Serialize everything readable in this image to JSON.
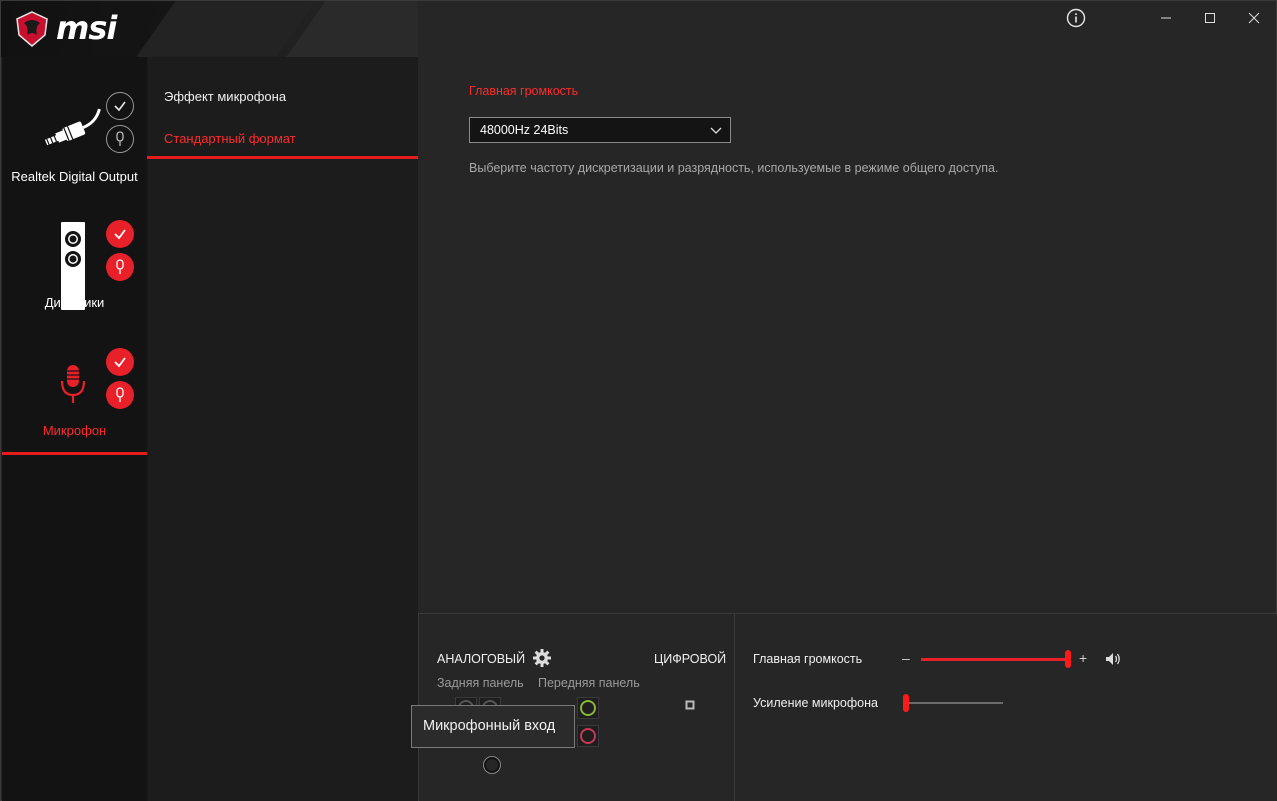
{
  "app": {
    "logo_text": "msi"
  },
  "devices": [
    {
      "label": "Realtek Digital Output",
      "icon": "digital-output-cable-icon",
      "active": false
    },
    {
      "label": "Динамики",
      "icon": "speakers-icon",
      "active": false
    },
    {
      "label": "Микрофон",
      "icon": "microphone-icon",
      "active": true
    }
  ],
  "submenu": {
    "items": [
      {
        "label": "Эффект микрофона",
        "active": false
      },
      {
        "label": "Стандартный формат",
        "active": true
      }
    ]
  },
  "main": {
    "section_title": "Главная громкость",
    "format_select": {
      "value": "48000Hz 24Bits"
    },
    "description": "Выберите частоту дискретизации и разрядность, используемые в режиме общего доступа."
  },
  "connectors": {
    "analog_label": "АНАЛОГОВЫЙ",
    "digital_label": "ЦИФРОВОЙ",
    "rear_panel_label": "Задняя панель",
    "front_panel_label": "Передняя панель",
    "tooltip": "Микрофонный вход"
  },
  "levels": {
    "master_volume": {
      "label": "Главная громкость",
      "value": 1.0,
      "minus": "–",
      "plus": "+"
    },
    "mic_boost": {
      "label": "Усиление микрофона",
      "value": 0.0
    }
  },
  "colors": {
    "accent": "#e8202a",
    "jack_green": "#8ab43a",
    "jack_pink": "#c23a5a"
  }
}
